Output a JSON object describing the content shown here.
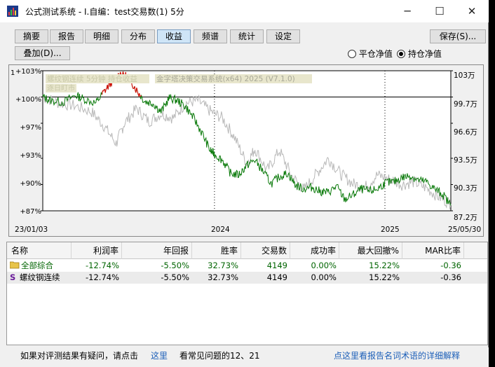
{
  "window": {
    "title": "公式测试系统 - I.自编：test交易数(1) 5分"
  },
  "tabs": [
    {
      "label": "摘要",
      "active": false
    },
    {
      "label": "报告",
      "active": false
    },
    {
      "label": "明细",
      "active": false
    },
    {
      "label": "分布",
      "active": false
    },
    {
      "label": "收益",
      "active": true
    },
    {
      "label": "频谱",
      "active": false
    },
    {
      "label": "统计",
      "active": false
    },
    {
      "label": "设定",
      "active": false
    }
  ],
  "toolbar": {
    "save_label": "保存(S)...",
    "overlay_label": "叠加(D)...",
    "radio_avg_label": "平仓净值",
    "radio_pos_label": "持仓净值",
    "selected_mode": "持仓净值"
  },
  "chart": {
    "legend_text": "螺纹钢连续 5分钟 持仓收益",
    "legend_sub": "逐日盯市",
    "watermark": "金字塔决策交易系统(x64) 2025 (V7.1.0)",
    "corner_label": "1",
    "left_ticks": [
      "+103%",
      "+100%",
      "+97%",
      "+93%",
      "+90%",
      "+87%"
    ],
    "right_ticks": [
      "103万",
      "99.7万",
      "96.6万",
      "93.5万",
      "90.3万",
      "87.2万"
    ],
    "x_labels": [
      "23/01/03",
      "2024",
      "2025",
      "25/05/30"
    ]
  },
  "chart_data": {
    "type": "line",
    "title": "",
    "xlabel": "",
    "ylabel": "",
    "x_range": [
      "23/01/03",
      "25/05/30"
    ],
    "y_left_range": [
      "+87%",
      "+103%"
    ],
    "y_right_range": [
      "87.2万",
      "103万"
    ],
    "grid": true,
    "series": [
      {
        "name": "",
        "color": "#0a7a0a",
        "highlight_color": "#e00000",
        "x": [
          0,
          0.02,
          0.05,
          0.08,
          0.1,
          0.13,
          0.15,
          0.17,
          0.19,
          0.21,
          0.23,
          0.25,
          0.27,
          0.29,
          0.31,
          0.33,
          0.35,
          0.37,
          0.39,
          0.41,
          0.42,
          0.44,
          0.46,
          0.48,
          0.5,
          0.52,
          0.54,
          0.56,
          0.58,
          0.6,
          0.62,
          0.64,
          0.66,
          0.68,
          0.7,
          0.72,
          0.74,
          0.76,
          0.78,
          0.8,
          0.82,
          0.84,
          0.86,
          0.88,
          0.9,
          0.92,
          0.94,
          0.96,
          0.98,
          1.0
        ],
        "values": [
          100.0,
          99.6,
          99.4,
          100.2,
          99.8,
          99.3,
          100.6,
          101.8,
          102.7,
          102.3,
          100.8,
          99.5,
          99.3,
          98.3,
          99.9,
          99.6,
          98.9,
          97.6,
          95.9,
          93.9,
          93.5,
          92.8,
          91.3,
          91.1,
          92.2,
          92.8,
          91.5,
          90.1,
          90.9,
          91.3,
          89.9,
          89.5,
          89.7,
          89.2,
          89.1,
          89.8,
          88.3,
          88.8,
          89.5,
          89.2,
          89.5,
          90.2,
          90.3,
          90.8,
          91.0,
          90.5,
          90.3,
          89.5,
          88.9,
          87.6
        ]
      },
      {
        "name": "",
        "color": "#b8b8b8",
        "x": [
          0,
          0.04,
          0.08,
          0.12,
          0.15,
          0.18,
          0.2,
          0.23,
          0.26,
          0.29,
          0.32,
          0.35,
          0.38,
          0.41,
          0.44,
          0.47,
          0.5,
          0.52,
          0.55,
          0.58,
          0.61,
          0.64,
          0.67,
          0.7,
          0.73,
          0.76,
          0.79,
          0.82,
          0.85,
          0.88,
          0.91,
          0.94,
          0.97,
          1.0
        ],
        "values": [
          100.0,
          99.3,
          99.0,
          98.3,
          96.7,
          94.7,
          97.0,
          98.7,
          97.2,
          98.1,
          97.6,
          99.3,
          99.6,
          98.4,
          97.6,
          95.4,
          92.4,
          94.1,
          91.6,
          93.9,
          91.0,
          89.4,
          91.2,
          93.0,
          91.2,
          90.1,
          89.7,
          91.1,
          90.6,
          90.0,
          90.3,
          89.6,
          88.6,
          87.8
        ]
      }
    ]
  },
  "table": {
    "headers": [
      "名称",
      "利润率",
      "年回报",
      "胜率",
      "交易数",
      "成功率",
      "最大回撤%",
      "MAR比率"
    ],
    "rows": [
      {
        "icon": "folder-icon",
        "cells": [
          "全部综合",
          "-12.74%",
          "-5.50%",
          "32.73%",
          "4149",
          "0.00%",
          "15.22%",
          "-0.36"
        ]
      },
      {
        "icon": "s-icon",
        "glyph": "S",
        "cells": [
          "螺纹钢连续",
          "-12.74%",
          "-5.50%",
          "32.73%",
          "4149",
          "0.00%",
          "15.22%",
          "-0.36"
        ]
      }
    ]
  },
  "status": {
    "question_text": "如果对评测结果有疑问，请点击",
    "here_link": "这里",
    "faq_text": "看常见问题的12、21",
    "glossary_link": "点这里看报告名词术语的详细解释"
  },
  "colors": {
    "profit_color": "#e00000",
    "equity_color": "#0a7a0a",
    "compare_color": "#b8b8b8",
    "link_color": "#1c5fb8",
    "negative_text": "#006400",
    "positive_text": "#006400"
  }
}
